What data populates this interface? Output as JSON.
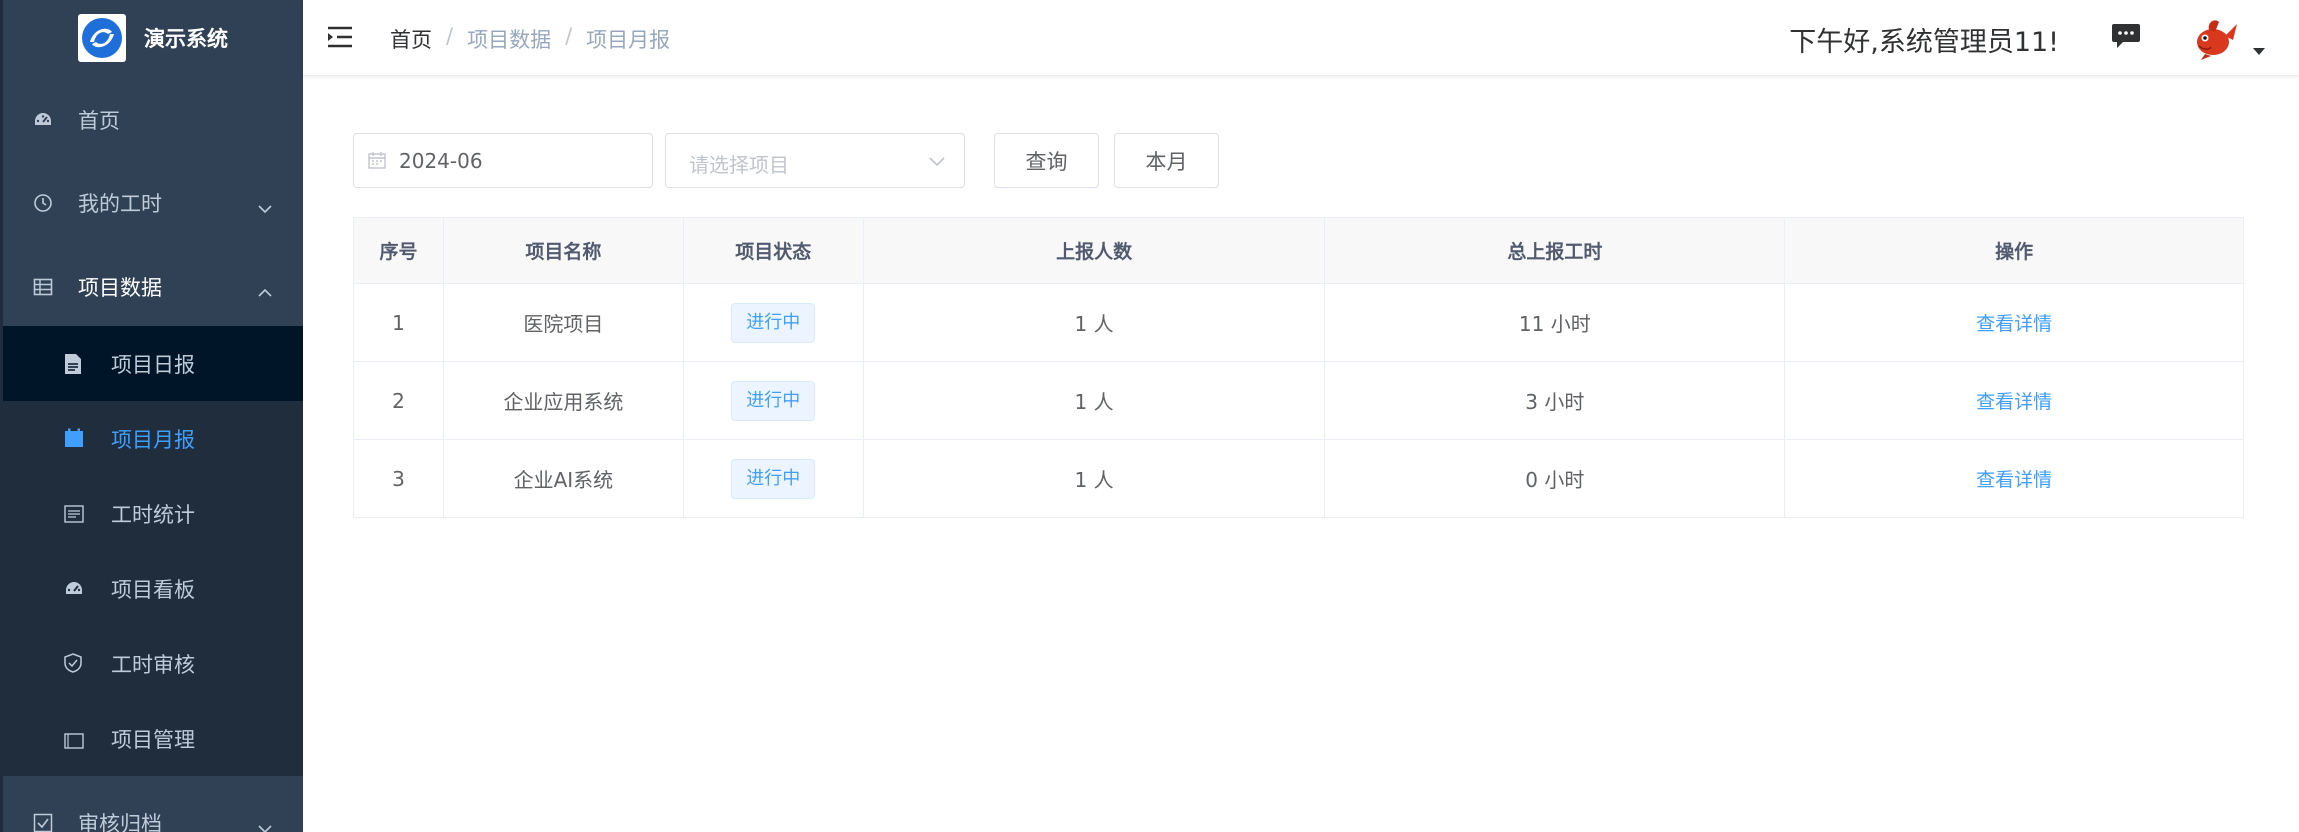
{
  "app": {
    "title": "演示系统"
  },
  "sidebar": {
    "items": [
      {
        "label": "首页",
        "icon": "dashboard-icon"
      },
      {
        "label": "我的工时",
        "icon": "clock-icon"
      },
      {
        "label": "项目数据",
        "icon": "table-icon"
      }
    ],
    "submenu": [
      {
        "label": "项目日报",
        "icon": "document-icon"
      },
      {
        "label": "项目月报",
        "icon": "calendar-icon"
      },
      {
        "label": "工时统计",
        "icon": "chart-icon"
      },
      {
        "label": "项目看板",
        "icon": "dashboard-icon"
      },
      {
        "label": "工时审核",
        "icon": "shield-icon"
      },
      {
        "label": "项目管理",
        "icon": "folder-icon"
      }
    ],
    "bottom_item": {
      "label": "审核归档",
      "icon": "checkbox-icon"
    }
  },
  "header": {
    "breadcrumb": [
      "首页",
      "项目数据",
      "项目月报"
    ],
    "breadcrumb_sep": "/",
    "greeting": "下午好,系统管理员11!"
  },
  "filters": {
    "date_value": "2024-06",
    "project_placeholder": "请选择项目",
    "query_label": "查询",
    "month_label": "本月"
  },
  "table": {
    "columns": [
      "序号",
      "项目名称",
      "项目状态",
      "上报人数",
      "总上报工时",
      "操作"
    ],
    "rows": [
      {
        "index": "1",
        "name": "医院项目",
        "status": "进行中",
        "reporters": "1 人",
        "hours": "11 小时",
        "action": "查看详情"
      },
      {
        "index": "2",
        "name": "企业应用系统",
        "status": "进行中",
        "reporters": "1 人",
        "hours": "3 小时",
        "action": "查看详情"
      },
      {
        "index": "3",
        "name": "企业AI系统",
        "status": "进行中",
        "reporters": "1 人",
        "hours": "0 小时",
        "action": "查看详情"
      }
    ]
  },
  "colors": {
    "sidebar_bg": "#304156",
    "submenu_bg": "#1f2d3d",
    "accent": "#409eff",
    "tag_bg": "#ecf5ff"
  }
}
